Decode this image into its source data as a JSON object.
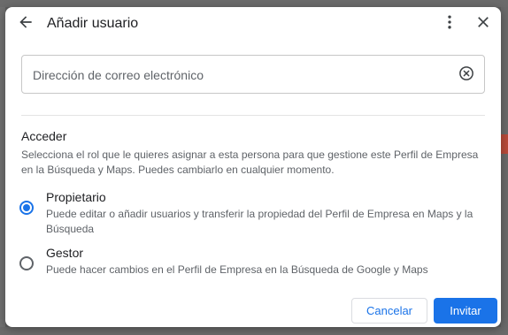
{
  "dialog": {
    "title": "Añadir usuario",
    "icons": {
      "back": "arrow-back-icon",
      "more": "more-vert-icon",
      "close": "close-icon",
      "clear": "clear-circle-icon"
    }
  },
  "email": {
    "placeholder": "Dirección de correo electrónico",
    "value": ""
  },
  "access": {
    "heading": "Acceder",
    "description": "Selecciona el rol que le quieres asignar a esta persona para que gestione este Perfil de Empresa en la Búsqueda y Maps. Puedes cambiarlo en cualquier momento.",
    "roles": [
      {
        "title": "Propietario",
        "description": "Puede editar o añadir usuarios y transferir la propiedad del Perfil de Empresa en Maps y la Búsqueda",
        "selected": true
      },
      {
        "title": "Gestor",
        "description": "Puede hacer cambios en el Perfil de Empresa en la Búsqueda de Google y Maps",
        "selected": false
      }
    ]
  },
  "actions": {
    "cancel_label": "Cancelar",
    "invite_label": "Invitar"
  },
  "colors": {
    "accent": "#1a73e8",
    "text_primary": "#202124",
    "text_secondary": "#5f6368",
    "overlay": "#5f5f5f"
  }
}
